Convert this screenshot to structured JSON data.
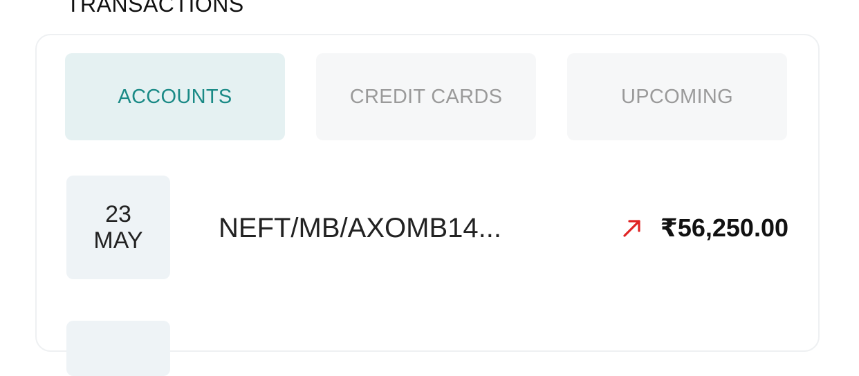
{
  "section": {
    "title": "TRANSACTIONS"
  },
  "tabs": [
    {
      "label": "ACCOUNTS",
      "active": true
    },
    {
      "label": "CREDIT CARDS",
      "active": false
    },
    {
      "label": "UPCOMING",
      "active": false
    }
  ],
  "transactions": [
    {
      "day": "23",
      "month": "MAY",
      "description": "NEFT/MB/AXOMB14...",
      "direction_icon": "arrow-up-right-icon",
      "direction_color": "#e02424",
      "amount": "₹56,250.00"
    }
  ],
  "colors": {
    "accent": "#1a8a86",
    "active_tab_bg": "#e5f1f2",
    "inactive_tab_bg": "#f6f7f8",
    "inactive_tab_text": "#9a9a9a",
    "date_box_bg": "#eef3f6"
  }
}
